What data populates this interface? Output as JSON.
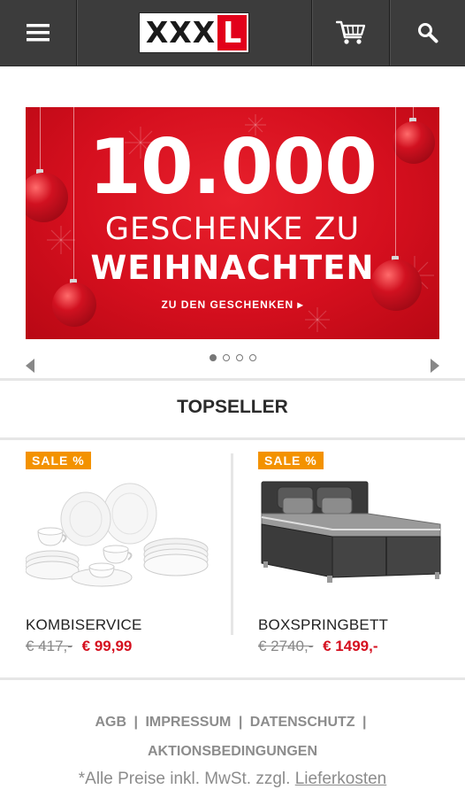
{
  "header": {
    "logo_text": "XXX",
    "logo_accent_text": "L",
    "menu_icon": "hamburger-icon",
    "cart_icon": "cart-icon",
    "search_icon": "search-icon",
    "colors": {
      "bar": "#3c3c3c",
      "brand_red": "#e2001a"
    }
  },
  "banner": {
    "headline_number": "10.000",
    "headline_line2": "GESCHENKE ZU",
    "headline_line3": "WEIHNACHTEN",
    "cta": "ZU DEN GESCHENKEN ▸",
    "background_color": "#d50f1e"
  },
  "carousel": {
    "slide_count": 4,
    "active_index": 0
  },
  "topseller": {
    "title": "TOPSELLER",
    "products": [
      {
        "badge": "SALE %",
        "name": "KOMBISERVICE",
        "old_price": "€ 417,-",
        "new_price": "€ 99,99",
        "image": "dinnerware-set"
      },
      {
        "badge": "SALE %",
        "name": "BOXSPRINGBETT",
        "old_price": "€ 2740,-",
        "new_price": "€ 1499,-",
        "image": "boxspring-bed"
      }
    ]
  },
  "footer": {
    "links": [
      "AGB",
      "IMPRESSUM",
      "DATENSCHUTZ"
    ],
    "links_line2": "AKTIONSBEDINGUNGEN",
    "separator": "|",
    "note_prefix": "*Alle Preise inkl. MwSt. zzgl.",
    "note_link": "Lieferkosten"
  }
}
